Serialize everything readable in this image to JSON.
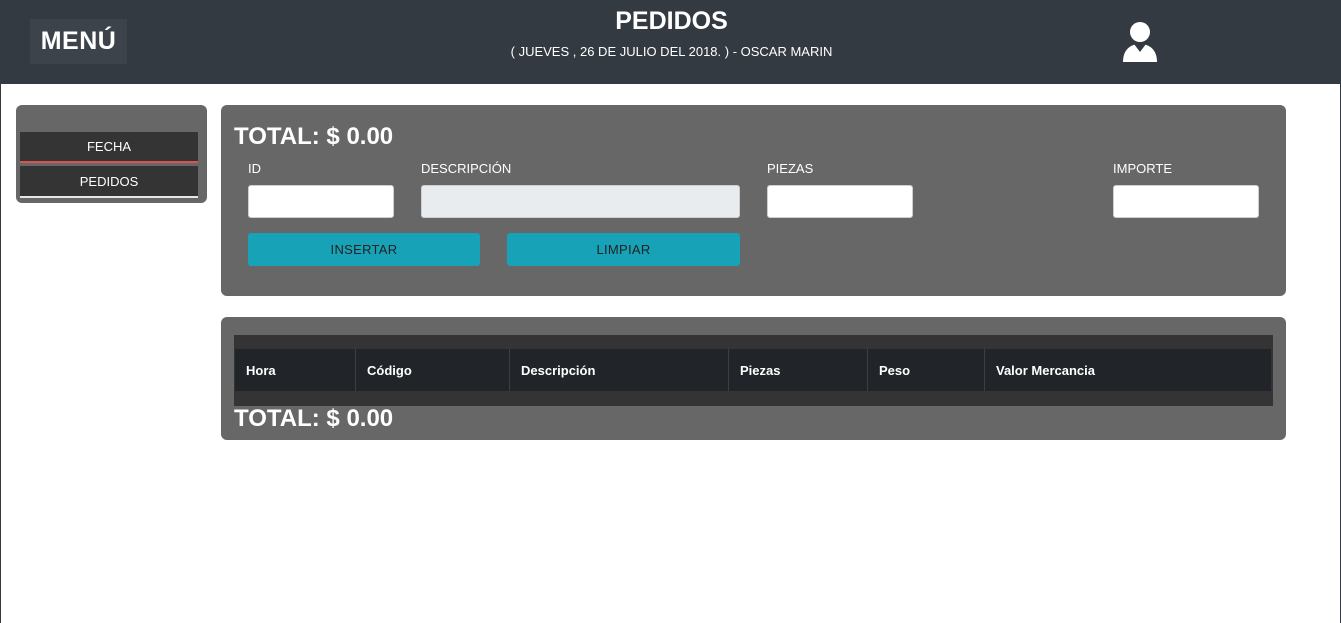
{
  "header": {
    "menu_label": "MENÚ",
    "title": "PEDIDOS",
    "subtitle": "( JUEVES , 26 DE JULIO DEL 2018. ) - OSCAR MARIN",
    "user_icon": "user-icon"
  },
  "sidebar": {
    "items": [
      {
        "label": "FECHA"
      },
      {
        "label": "PEDIDOS"
      }
    ]
  },
  "form": {
    "total": "TOTAL: $ 0.00",
    "fields": {
      "id": {
        "label": "ID",
        "value": ""
      },
      "descripcion": {
        "label": "DESCRIPCIÓN",
        "value": ""
      },
      "piezas": {
        "label": "PIEZAS",
        "value": ""
      },
      "importe": {
        "label": "IMPORTE",
        "value": ""
      }
    },
    "buttons": {
      "insertar": "INSERTAR",
      "limpiar": "LIMPIAR"
    }
  },
  "table": {
    "columns": [
      "Hora",
      "Código",
      "Descripción",
      "Piezas",
      "Peso",
      "Valor Mercancia"
    ],
    "rows": [],
    "total": "TOTAL: $ 0.00"
  },
  "colors": {
    "header_bg": "#343a42",
    "panel_bg": "#676767",
    "button_accent": "#17a2b8",
    "sidebar_active_underline": "#d9534f",
    "table_header_bg": "#212529"
  }
}
